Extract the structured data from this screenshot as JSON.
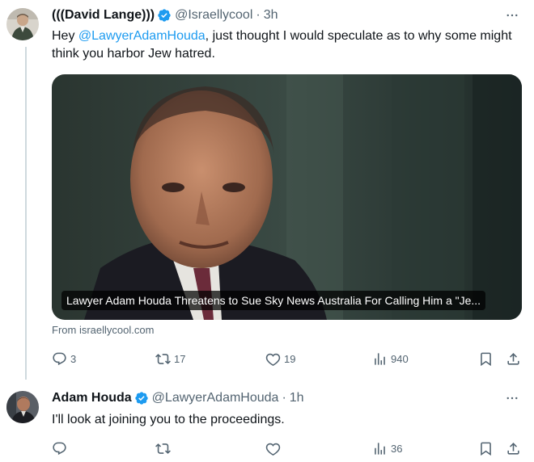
{
  "tweets": [
    {
      "name": "(((David Lange)))",
      "handle": "@Israellycool",
      "time": "3h",
      "text": {
        "before": "Hey ",
        "mention": "@LawyerAdamHouda",
        "after": ", just thought I would speculate as to why some might think you harbor Jew hatred."
      },
      "card": {
        "title": "Lawyer Adam Houda Threatens to Sue Sky News Australia For Calling Him a \"Je...",
        "source": "From israellycool.com"
      },
      "stats": {
        "replies": "3",
        "retweets": "17",
        "likes": "19",
        "views": "940"
      }
    },
    {
      "name": "Adam Houda",
      "handle": "@LawyerAdamHouda",
      "time": "1h",
      "text": "I'll look at joining you to the proceedings.",
      "stats": {
        "replies": "",
        "retweets": "",
        "likes": "",
        "views": "36"
      }
    }
  ],
  "separator": "·",
  "icons": {
    "verified": "verified-badge-icon",
    "more": "more-options-icon",
    "reply": "reply-icon",
    "retweet": "retweet-icon",
    "like": "like-icon",
    "views": "views-icon",
    "bookmark": "bookmark-icon",
    "share": "share-icon"
  },
  "colors": {
    "accent": "#1d9bf0",
    "secondary_text": "#536471",
    "thread_line": "#cfd9de"
  }
}
